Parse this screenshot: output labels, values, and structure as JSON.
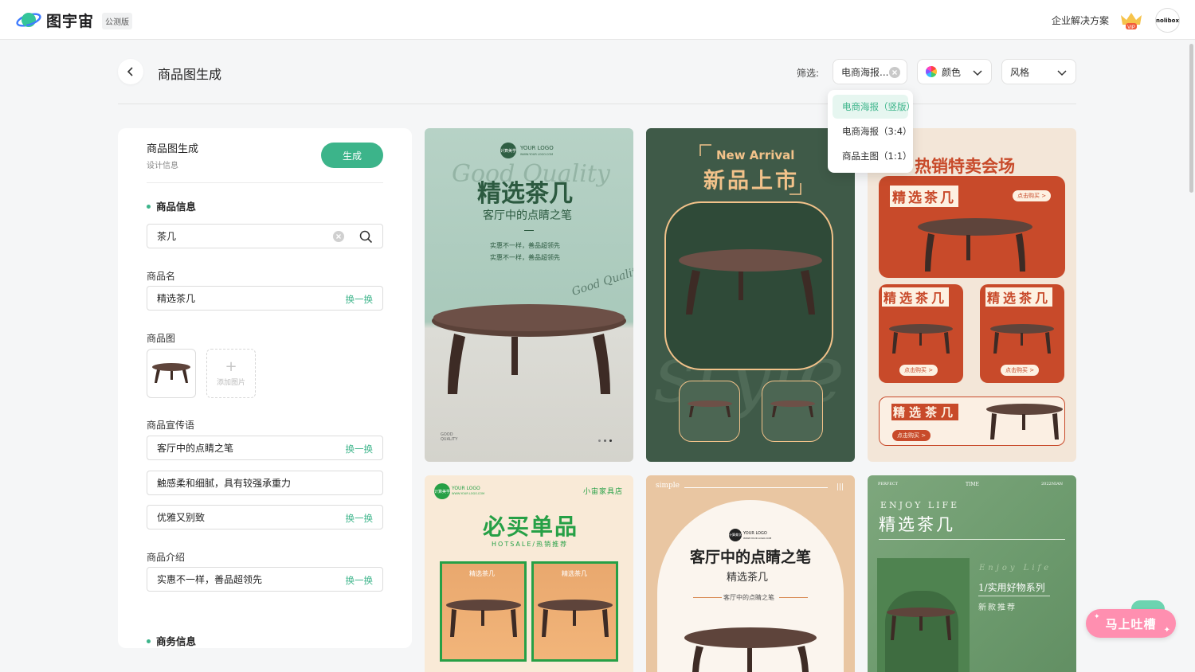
{
  "header": {
    "logo_text": "图宇宙",
    "beta_badge": "公测版",
    "enterprise_link": "企业解决方案",
    "vip_label": "VIP",
    "avatar_label": "nolibox"
  },
  "toolbar": {
    "page_title": "商品图生成",
    "filter_label": "筛选:",
    "type_filter_value": "电商海报...",
    "color_filter_label": "颜色",
    "style_filter_label": "风格",
    "type_options": [
      "电商海报（竖版）",
      "电商海报（3:4）",
      "商品主图（1:1）"
    ],
    "type_selected_index": 0
  },
  "panel": {
    "title": "商品图生成",
    "subtitle": "设计信息",
    "generate_label": "生成",
    "product_info_heading": "商品信息",
    "search_value": "茶几",
    "name_label": "商品名",
    "name_value": "精选茶几",
    "swap_label": "换一换",
    "image_label": "商品图",
    "add_image_label": "添加图片",
    "slogan_label": "商品宣传语",
    "slogans": [
      "客厅中的点睛之笔",
      "触感柔和细腻，具有较强承重力",
      "优雅又别致"
    ],
    "intro_label": "商品介绍",
    "intro_value": "实惠不一样，善品超领先",
    "business_heading": "商务信息"
  },
  "cards": {
    "c1": {
      "logo_badge": "计算美学",
      "logo": "YOUR LOGO",
      "logo_sub": "WWW.YOUR LOGO.COM",
      "script": "Good Quality",
      "title": "精选茶几",
      "subtitle": "客厅中的点睛之笔",
      "line1": "实惠不一样，善品超领先",
      "line2": "实惠不一样，善品超领先",
      "script2": "Good Quality",
      "footer": "GOOD QUALITY"
    },
    "c2": {
      "eyebrow": "New Arrival",
      "title": "新品上市",
      "bg_text": "style"
    },
    "c3": {
      "title": "热销特卖会场",
      "product": "精选茶几",
      "buy": "点击购买 >"
    },
    "c4": {
      "logo_badge": "计算美学",
      "logo": "YOUR LOGO",
      "logo_sub": "WWW.YOUR LOGO.COM",
      "shop": "小宙家具店",
      "title": "必买单品",
      "subtitle": "HOTSALE/热销推荐",
      "box_label": "精选茶几"
    },
    "c5": {
      "corner": "simple",
      "logo_badge": "计算美学",
      "logo": "YOUR LOGO",
      "logo_sub": "WWW.YOUR LOGO.COM",
      "title": "客厅中的点睛之笔",
      "subtitle": "精选茶几",
      "tagline": "客厅中的点睛之笔"
    },
    "c6": {
      "top_left": "PERFECT",
      "top_mid": "TIME",
      "top_right": "2022NIAN",
      "eyebrow": "ENJOY LIFE",
      "title": "精选茶几",
      "script": "Enjoy Life",
      "series": "1/实用好物系列",
      "new": "新款推荐"
    }
  },
  "feedback_button": "马上吐槽",
  "colors": {
    "accent": "#3cb48a",
    "card1_bg": "#b3cfc3",
    "card2_bg": "#3f5a48",
    "card3_bg": "#f3e6d8",
    "card3_red": "#c84a2a",
    "card4_bg": "#f9ead7",
    "card4_green": "#26a046",
    "card5_bg": "#e9c6a2",
    "card6_bg": "#6c9a6d",
    "feedback": "#ff8fb0"
  }
}
